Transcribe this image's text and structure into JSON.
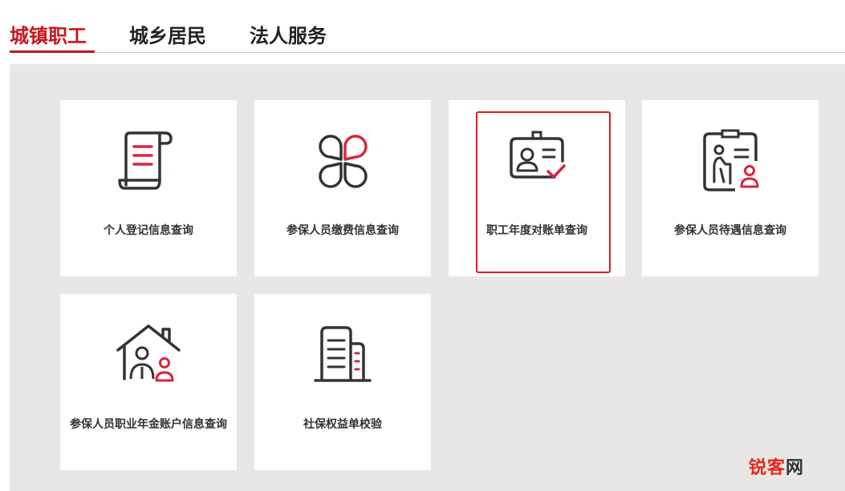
{
  "tabs": [
    {
      "label": "城镇职工",
      "active": true
    },
    {
      "label": "城乡居民",
      "active": false
    },
    {
      "label": "法人服务",
      "active": false
    }
  ],
  "cards": [
    {
      "label": "个人登记信息查询",
      "icon": "scroll-document-icon"
    },
    {
      "label": "参保人员缴费信息查询",
      "icon": "four-petal-icon"
    },
    {
      "label": "职工年度对账单查询",
      "icon": "id-card-check-icon",
      "selected": true
    },
    {
      "label": "参保人员待遇信息查询",
      "icon": "clipboard-elderly-icon"
    },
    {
      "label": "参保人员职业年金账户信息查询",
      "icon": "house-family-icon"
    },
    {
      "label": "社保权益单校验",
      "icon": "building-icon"
    }
  ],
  "watermark": {
    "part1": "锐客",
    "part2": "网"
  },
  "colors": {
    "accent": "#c8161d",
    "icon_red": "#d7263d",
    "icon_dark": "#333333",
    "panel_bg": "#e8e7e5"
  }
}
